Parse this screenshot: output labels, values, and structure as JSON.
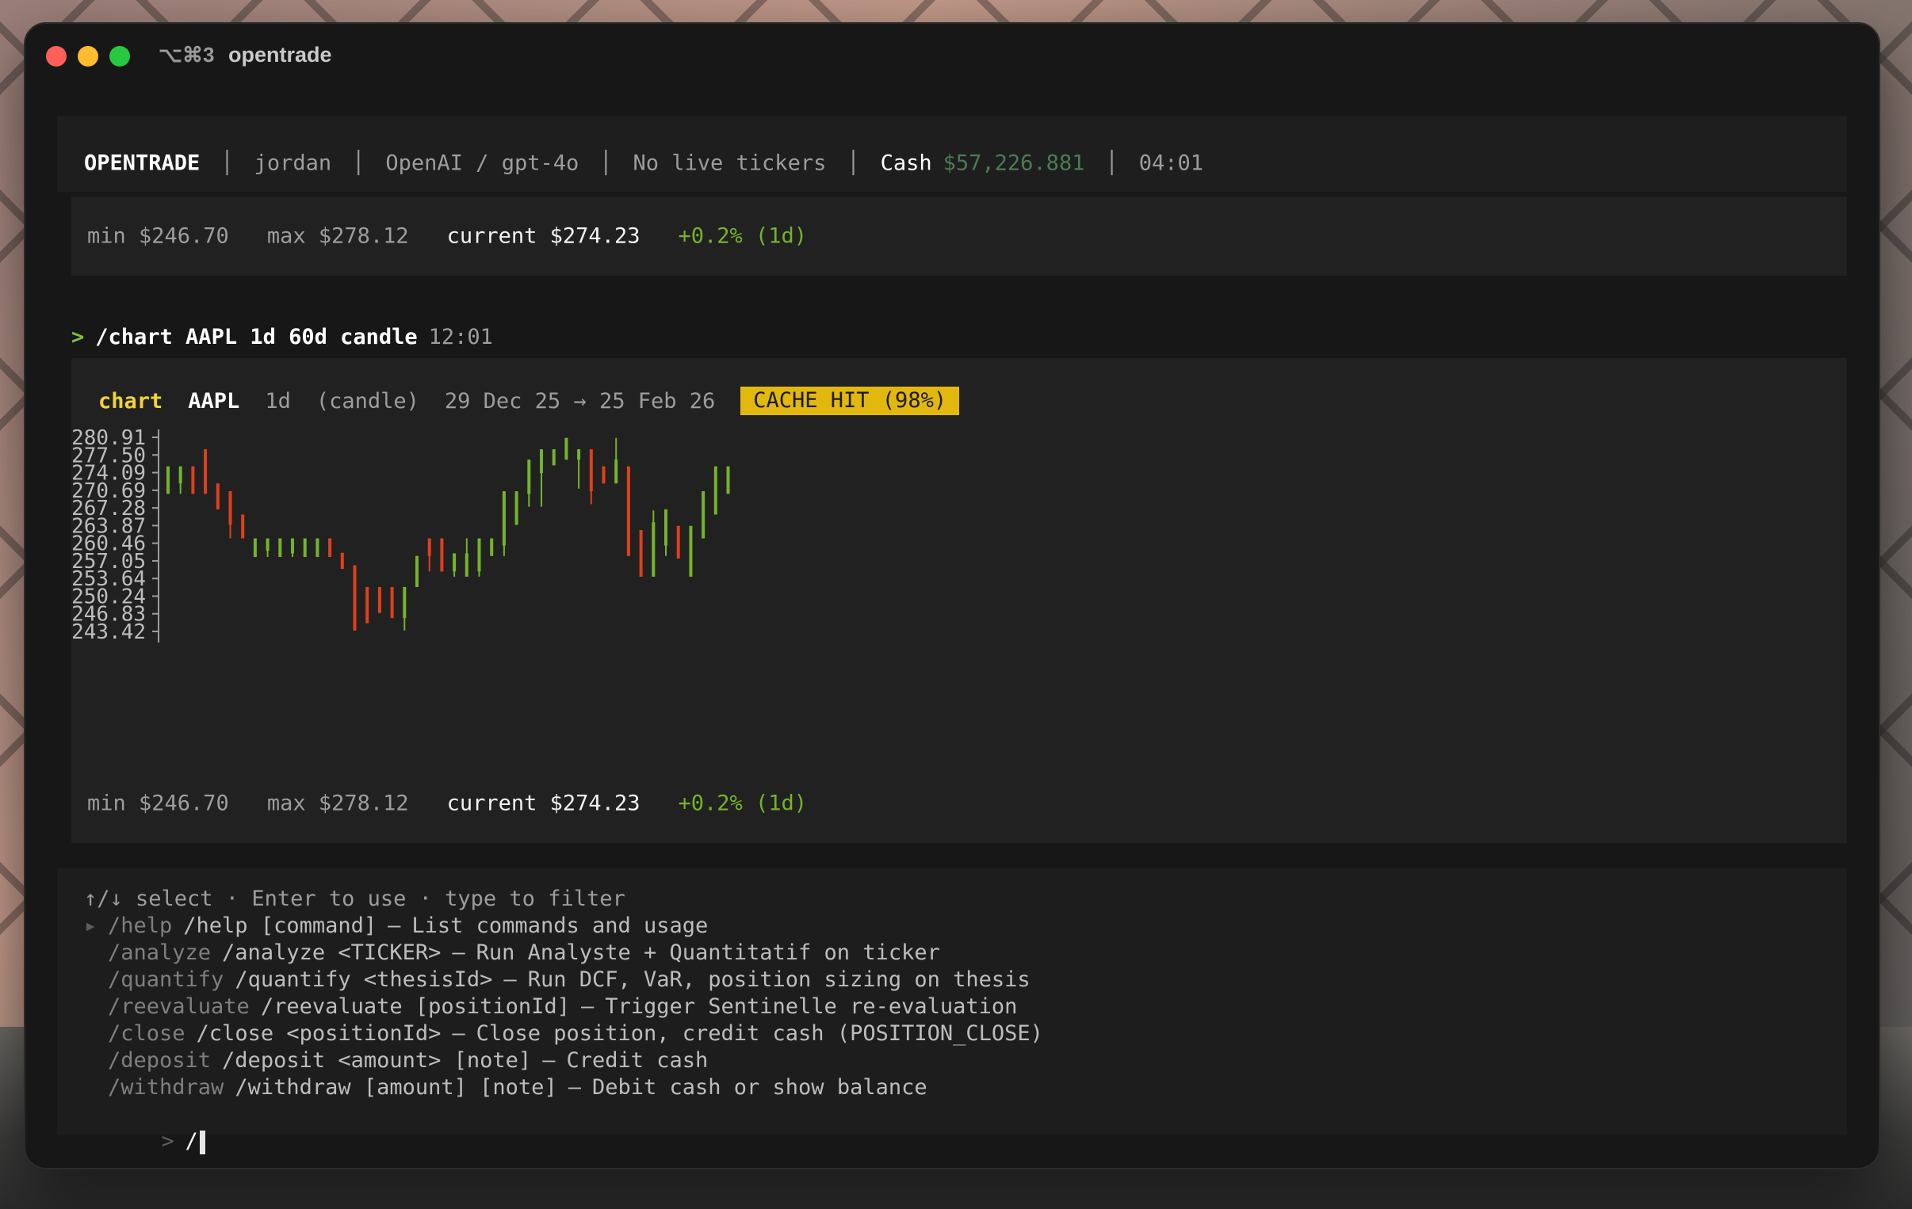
{
  "window": {
    "shortcut": "⌥⌘3",
    "title": "opentrade"
  },
  "status_bar": {
    "brand": "OPENTRADE",
    "user": "jordan",
    "model": "OpenAI / gpt-4o",
    "tickers": "No live tickers",
    "cash_label": "Cash",
    "cash_value": "$57,226.881",
    "time": "04:01"
  },
  "top_stats": {
    "min": "min $246.70",
    "max": "max $278.12",
    "current": "current $274.23",
    "change": "+0.2% (1d)"
  },
  "command_line": {
    "caret": ">",
    "command": "/chart AAPL 1d 60d candle",
    "time": "12:01"
  },
  "chart_panel": {
    "label": "chart",
    "symbol": "AAPL",
    "interval": "1d",
    "kind": "(candle)",
    "range": "29 Dec 25 → 25 Feb 26",
    "badge": "CACHE HIT (98%)",
    "stats": {
      "min": "min $246.70",
      "max": "max $278.12",
      "current": "current $274.23",
      "change": "+0.2% (1d)"
    }
  },
  "chart_data": {
    "type": "candlestick",
    "y_ticks": [
      "280.91",
      "277.50",
      "274.09",
      "270.69",
      "267.28",
      "263.87",
      "260.46",
      "257.05",
      "253.64",
      "250.24",
      "246.83",
      "243.42"
    ],
    "ylim": [
      243.42,
      280.91
    ],
    "up_color": "#74b42a",
    "down_color": "#e0401a",
    "candles": [
      {
        "o": 270.0,
        "c": 275.3,
        "h": 275.3,
        "l": 270.0
      },
      {
        "o": 272.0,
        "c": 275.3,
        "h": 275.3,
        "l": 270.0
      },
      {
        "o": 275.3,
        "c": 270.0,
        "h": 275.3,
        "l": 270.0
      },
      {
        "o": 278.6,
        "c": 270.0,
        "h": 278.6,
        "l": 270.0
      },
      {
        "o": 272.0,
        "c": 267.0,
        "h": 272.0,
        "l": 267.0
      },
      {
        "o": 270.5,
        "c": 264.0,
        "h": 270.5,
        "l": 261.4
      },
      {
        "o": 266.0,
        "c": 261.4,
        "h": 266.0,
        "l": 261.4
      },
      {
        "o": 257.8,
        "c": 261.4,
        "h": 261.4,
        "l": 257.8
      },
      {
        "o": 259.0,
        "c": 261.4,
        "h": 261.4,
        "l": 257.8
      },
      {
        "o": 257.8,
        "c": 261.4,
        "h": 261.4,
        "l": 257.8
      },
      {
        "o": 258.5,
        "c": 261.4,
        "h": 261.4,
        "l": 257.8
      },
      {
        "o": 257.8,
        "c": 261.4,
        "h": 261.4,
        "l": 257.8
      },
      {
        "o": 257.8,
        "c": 261.4,
        "h": 261.4,
        "l": 257.8
      },
      {
        "o": 261.4,
        "c": 257.8,
        "h": 261.4,
        "l": 257.8
      },
      {
        "o": 258.6,
        "c": 255.5,
        "h": 258.6,
        "l": 255.5
      },
      {
        "o": 256.2,
        "c": 243.6,
        "h": 256.2,
        "l": 243.6
      },
      {
        "o": 252.0,
        "c": 245.0,
        "h": 252.0,
        "l": 245.0
      },
      {
        "o": 252.0,
        "c": 247.0,
        "h": 252.0,
        "l": 247.0
      },
      {
        "o": 252.0,
        "c": 246.0,
        "h": 252.0,
        "l": 246.0
      },
      {
        "o": 246.0,
        "c": 252.0,
        "h": 252.0,
        "l": 243.6
      },
      {
        "o": 252.0,
        "c": 258.0,
        "h": 258.0,
        "l": 252.0
      },
      {
        "o": 261.4,
        "c": 258.0,
        "h": 261.4,
        "l": 255.0
      },
      {
        "o": 261.4,
        "c": 255.0,
        "h": 261.4,
        "l": 255.0
      },
      {
        "o": 255.0,
        "c": 258.5,
        "h": 258.5,
        "l": 254.0
      },
      {
        "o": 254.0,
        "c": 258.5,
        "h": 261.4,
        "l": 254.0
      },
      {
        "o": 255.0,
        "c": 261.4,
        "h": 261.4,
        "l": 254.0
      },
      {
        "o": 258.0,
        "c": 261.4,
        "h": 261.4,
        "l": 258.0
      },
      {
        "o": 260.0,
        "c": 270.5,
        "h": 270.5,
        "l": 258.0
      },
      {
        "o": 264.0,
        "c": 270.5,
        "h": 270.5,
        "l": 264.0
      },
      {
        "o": 270.0,
        "c": 276.6,
        "h": 276.6,
        "l": 267.5
      },
      {
        "o": 274.0,
        "c": 278.6,
        "h": 278.6,
        "l": 267.5
      },
      {
        "o": 275.5,
        "c": 278.6,
        "h": 278.6,
        "l": 275.5
      },
      {
        "o": 276.6,
        "c": 280.8,
        "h": 280.8,
        "l": 276.6
      },
      {
        "o": 276.6,
        "c": 278.6,
        "h": 278.6,
        "l": 271.0
      },
      {
        "o": 278.6,
        "c": 270.5,
        "h": 278.6,
        "l": 268.0
      },
      {
        "o": 275.3,
        "c": 272.0,
        "h": 275.3,
        "l": 272.0
      },
      {
        "o": 272.0,
        "c": 276.6,
        "h": 280.8,
        "l": 272.0
      },
      {
        "o": 275.3,
        "c": 258.0,
        "h": 275.3,
        "l": 258.0
      },
      {
        "o": 263.0,
        "c": 254.0,
        "h": 263.0,
        "l": 254.0
      },
      {
        "o": 254.0,
        "c": 264.5,
        "h": 266.8,
        "l": 254.0
      },
      {
        "o": 260.0,
        "c": 267.0,
        "h": 267.0,
        "l": 258.0
      },
      {
        "o": 263.8,
        "c": 257.5,
        "h": 263.8,
        "l": 257.5
      },
      {
        "o": 254.0,
        "c": 263.8,
        "h": 263.8,
        "l": 254.0
      },
      {
        "o": 261.4,
        "c": 270.5,
        "h": 270.5,
        "l": 261.4
      },
      {
        "o": 266.0,
        "c": 275.3,
        "h": 275.3,
        "l": 266.0
      },
      {
        "o": 270.0,
        "c": 275.3,
        "h": 275.3,
        "l": 270.0
      }
    ]
  },
  "command_menu": {
    "hint": "↑/↓ select · Enter to use · type to filter",
    "selected_marker": "▸",
    "items": [
      {
        "name": "/help",
        "usage": "/help [command]",
        "sep": "—",
        "desc": "List commands and usage"
      },
      {
        "name": "/analyze",
        "usage": "/analyze <TICKER>",
        "sep": "—",
        "desc": "Run Analyste + Quantitatif on ticker"
      },
      {
        "name": "/quantify",
        "usage": "/quantify <thesisId>",
        "sep": "—",
        "desc": "Run DCF, VaR, position sizing on thesis"
      },
      {
        "name": "/reevaluate",
        "usage": "/reevaluate [positionId]",
        "sep": "—",
        "desc": "Trigger Sentinelle re-evaluation"
      },
      {
        "name": "/close",
        "usage": "/close <positionId>",
        "sep": "—",
        "desc": "Close position, credit cash (POSITION_CLOSE)"
      },
      {
        "name": "/deposit",
        "usage": "/deposit <amount> [note]",
        "sep": "—",
        "desc": "Credit cash"
      },
      {
        "name": "/withdraw",
        "usage": "/withdraw [amount] [note]",
        "sep": "—",
        "desc": "Debit cash or show balance"
      }
    ],
    "input_caret": ">",
    "input_value": "/"
  }
}
